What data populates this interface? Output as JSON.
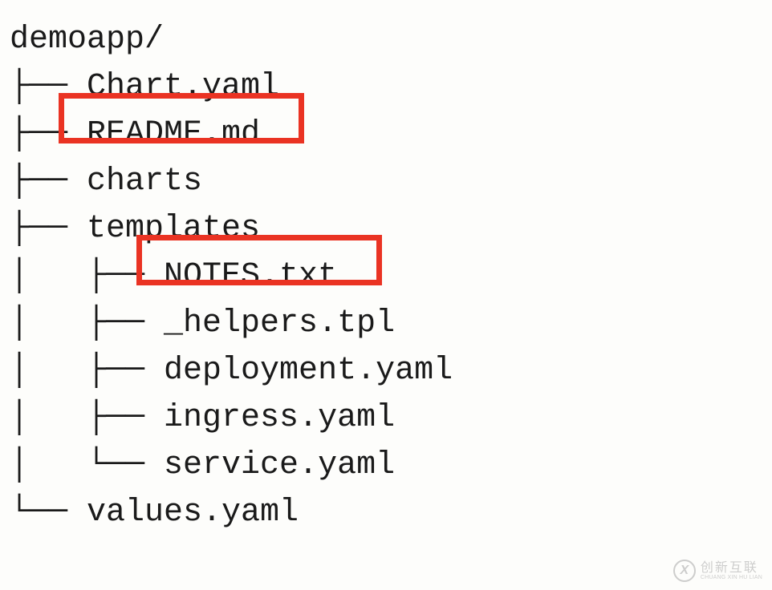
{
  "root": "demoapp/",
  "items": [
    {
      "prefix": "├── ",
      "name": "Chart.yaml"
    },
    {
      "prefix": "├── ",
      "name": "README.md"
    },
    {
      "prefix": "├── ",
      "name": "charts"
    },
    {
      "prefix": "├── ",
      "name": "templates"
    },
    {
      "prefix": "│   ├── ",
      "name": "NOTES.txt"
    },
    {
      "prefix": "│   ├── ",
      "name": "_helpers.tpl"
    },
    {
      "prefix": "│   ├── ",
      "name": "deployment.yaml"
    },
    {
      "prefix": "│   ├── ",
      "name": "ingress.yaml"
    },
    {
      "prefix": "│   └── ",
      "name": "service.yaml"
    },
    {
      "prefix": "└── ",
      "name": "values.yaml"
    }
  ],
  "watermark": {
    "icon": "X",
    "main": "创新互联",
    "sub": "CHUANG XIN HU LIAN"
  }
}
